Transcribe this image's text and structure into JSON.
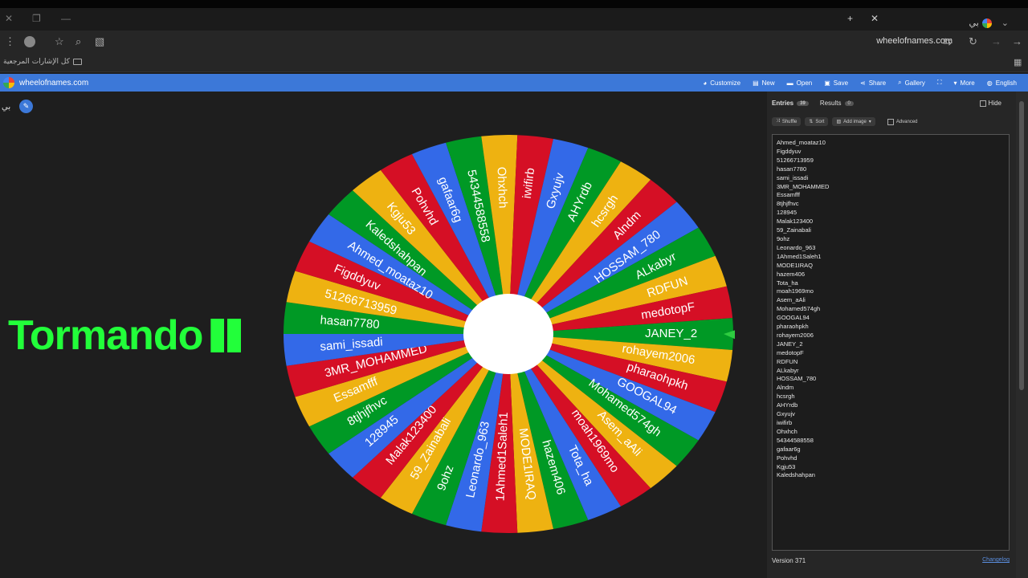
{
  "browser": {
    "tab_title": "بي",
    "url": "wheelofnames.com",
    "bookmarks_label": "كل الإشارات المرجعية"
  },
  "site": {
    "name": "wheelofnames.com",
    "menu": [
      {
        "icon": "palette-icon",
        "glyph": "◕",
        "label": "Customize"
      },
      {
        "icon": "new-file-icon",
        "glyph": "▤",
        "label": "New"
      },
      {
        "icon": "folder-icon",
        "glyph": "▬",
        "label": "Open"
      },
      {
        "icon": "save-icon",
        "glyph": "▣",
        "label": "Save"
      },
      {
        "icon": "share-icon",
        "glyph": "⋖",
        "label": "Share"
      },
      {
        "icon": "search-icon",
        "glyph": "⌕",
        "label": "Gallery"
      },
      {
        "icon": "fullscreen-icon",
        "glyph": "⛶",
        "label": ""
      },
      {
        "icon": "chevron-down-icon",
        "glyph": "▾",
        "label": "More"
      },
      {
        "icon": "globe-icon",
        "glyph": "◍",
        "label": "English"
      }
    ]
  },
  "main": {
    "profile_letter": "بي",
    "overlay_text": "Tormando"
  },
  "wheel": {
    "colors": {
      "blue": "#3369e8",
      "red": "#d50f25",
      "yellow": "#eeb211",
      "green": "#009925",
      "center": "#ffffff",
      "pointer": "#2ecc40"
    },
    "segments": [
      "JANEY_2",
      "rohayem2006",
      "pharaohpkh",
      "GOOGAL94",
      "Mohamed574gh",
      "Asem_aAli",
      "moah1969mo",
      "Tota_ha",
      "hazem406",
      "MODE1IRAQ",
      "1Ahmed1Saleh1",
      "Leonardo_963",
      "9ohz",
      "59_Zainabali",
      "Malak123400",
      "128945",
      "8tjhjfhvc",
      "Essamfff",
      "3MR_MOHAMMED",
      "sami_issadi",
      "hasan7780",
      "51266713959",
      "Figddyuv",
      "Ahmed_moataz10",
      "Kaledshahpan",
      "Kgju53",
      "Pohvhd",
      "gafaar6g",
      "54344588558",
      "Ohxhch",
      "iwifirb",
      "Gxyujv",
      "AHYrdb",
      "hcsrgh",
      "Alndm",
      "HOSSAM_780",
      "ALkabyr",
      "RDFUN",
      "medotopF"
    ]
  },
  "sidebar": {
    "tab_entries": "Entries",
    "entries_count": "39",
    "tab_results": "Results",
    "results_count": "0",
    "hide_label": "Hide",
    "shuffle_label": "Shuffle",
    "sort_label": "Sort",
    "add_image_label": "Add image",
    "advanced_label": "Advanced",
    "entries": [
      "Ahmed_moataz10",
      "Figddyuv",
      "51266713959",
      "hasan7780",
      "sami_issadi",
      "3MR_MOHAMMED",
      "Essamfff",
      "8tjhjfhvc",
      "128945",
      "Malak123400",
      "59_Zainabali",
      "9ohz",
      "Leonardo_963",
      "1Ahmed1Saleh1",
      "MODE1IRAQ",
      "hazem406",
      "Tota_ha",
      "moah1969mo",
      "Asem_aAli",
      "Mohamed574gh",
      "GOOGAL94",
      "pharaohpkh",
      "rohayem2006",
      "JANEY_2",
      "medotopF",
      "RDFUN",
      "ALkabyr",
      "HOSSAM_780",
      "Alndm",
      "hcsrgh",
      "AHYrdb",
      "Gxyujv",
      "iwifirb",
      "Ohxhch",
      "54344588558",
      "gafaar6g",
      "Pohvhd",
      "Kgju53",
      "Kaledshahpan"
    ],
    "version": "Version 371",
    "changelog": "Changelog"
  }
}
